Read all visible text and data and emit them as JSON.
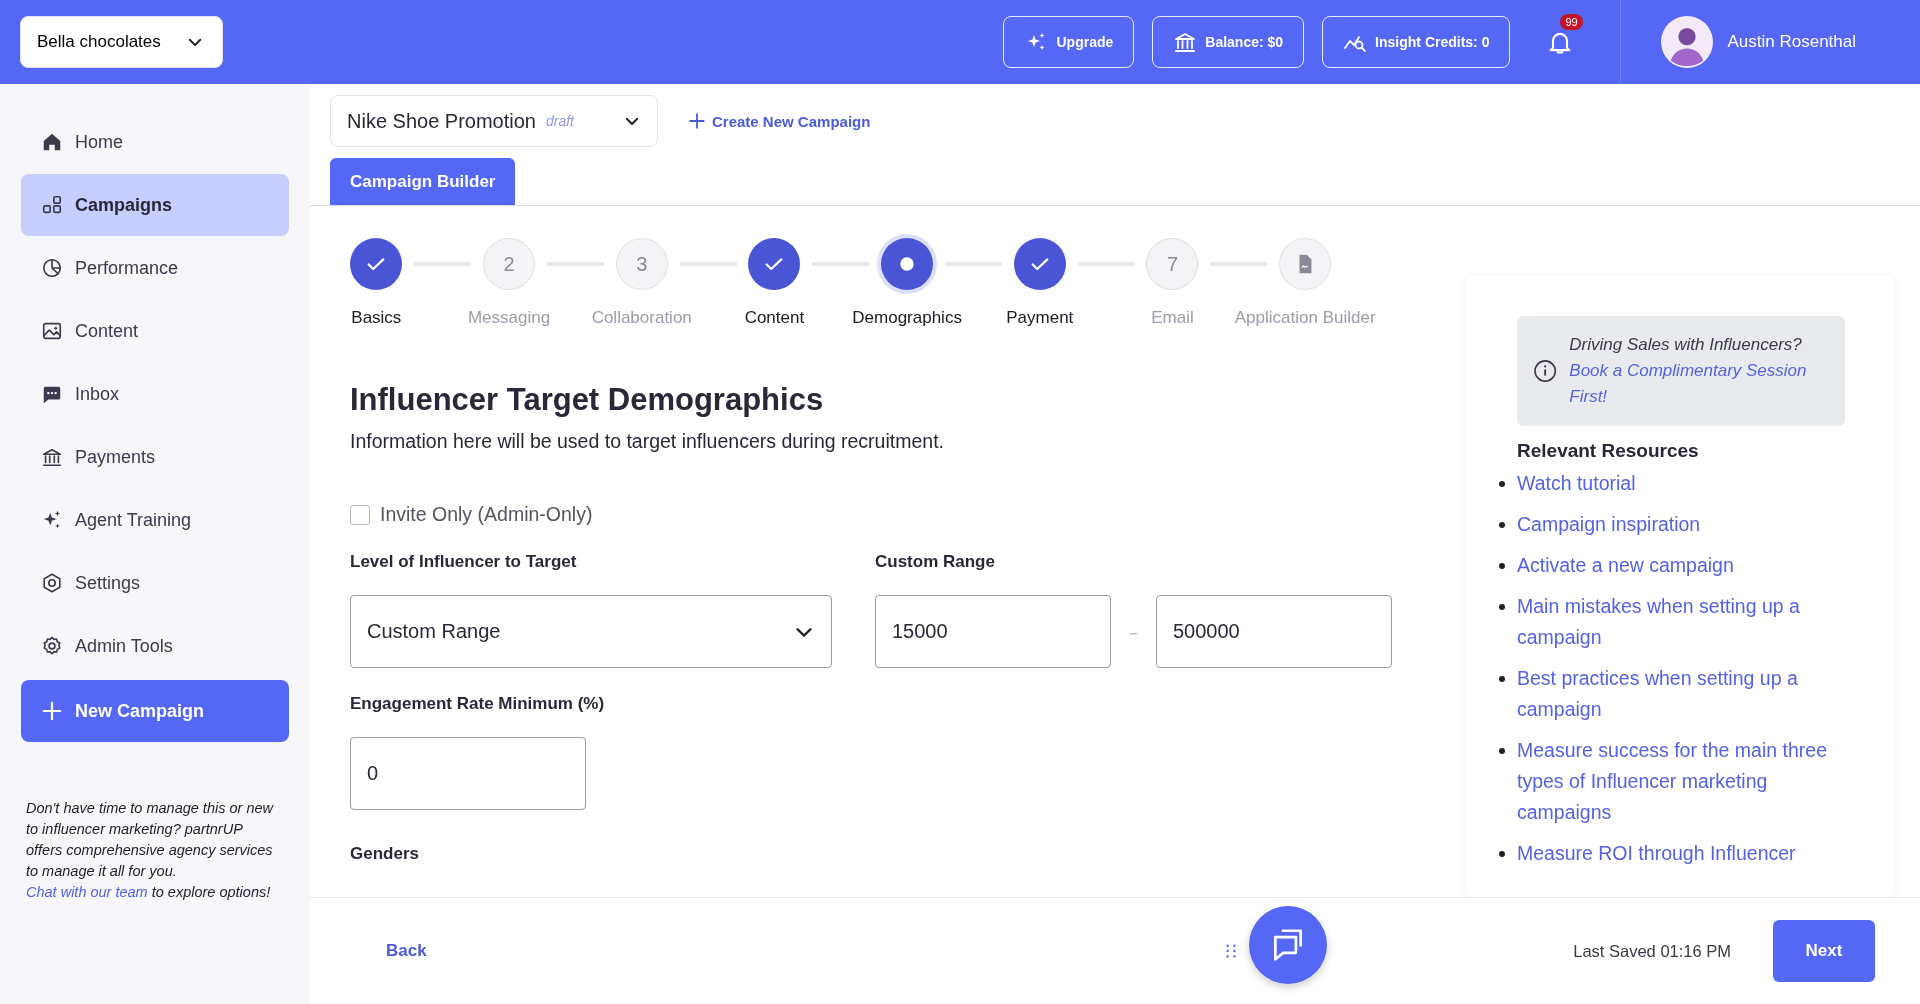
{
  "topbar": {
    "brand_selector": "Bella chocolates",
    "buttons": [
      {
        "kind": "upgrade",
        "label": "Upgrade"
      },
      {
        "kind": "balance",
        "label": "Balance: $0"
      },
      {
        "kind": "credits",
        "label": "Insight Credits: 0"
      }
    ],
    "notification_count": "99",
    "user": "Austin Rosenthal"
  },
  "sidebar": {
    "items": [
      {
        "kind": "home",
        "label": "Home",
        "selected": false
      },
      {
        "kind": "campaigns",
        "label": "Campaigns",
        "selected": true
      },
      {
        "kind": "performance",
        "label": "Performance",
        "selected": false
      },
      {
        "kind": "content",
        "label": "Content",
        "selected": false
      },
      {
        "kind": "inbox",
        "label": "Inbox",
        "selected": false
      },
      {
        "kind": "payments",
        "label": "Payments",
        "selected": false
      },
      {
        "kind": "agent",
        "label": "Agent Training",
        "selected": false
      },
      {
        "kind": "settings",
        "label": "Settings",
        "selected": false
      },
      {
        "kind": "admin",
        "label": "Admin Tools",
        "selected": false
      }
    ],
    "new_campaign": "New Campaign",
    "promo": {
      "before": "Don't have time to manage this or new to influencer marketing? partnrUP offers comprehensive agency services to manage it all for you. ",
      "link": "Chat with our team",
      "after": " to explore options!"
    }
  },
  "campaign": {
    "name": "Nike Shoe Promotion",
    "status": "draft",
    "create_link": "Create New Campaign",
    "tabs": [
      {
        "label": "Campaign Builder",
        "selected": true
      }
    ]
  },
  "steps": [
    {
      "label": "Basics",
      "complete": true,
      "current": false
    },
    {
      "label": "Messaging",
      "complete": false,
      "current": false,
      "number": "2"
    },
    {
      "label": "Collaboration",
      "complete": false,
      "current": false,
      "number": "3"
    },
    {
      "label": "Content",
      "complete": true,
      "current": false
    },
    {
      "label": "Demographics",
      "complete": false,
      "current": true
    },
    {
      "label": "Payment",
      "complete": true,
      "current": false
    },
    {
      "label": "Email",
      "complete": false,
      "current": false,
      "number": "7"
    },
    {
      "label": "Application Builder",
      "complete": false,
      "current": false
    }
  ],
  "form": {
    "title": "Influencer Target Demographics",
    "description": "Information here will be used to target influencers during recruitment.",
    "invite_only": {
      "label": "Invite Only (Admin-Only)",
      "checked": false
    },
    "level": {
      "label": "Level of Influencer to Target",
      "value": "Custom Range"
    },
    "custom_range": {
      "label": "Custom Range",
      "min": "15000",
      "separator": "–",
      "max": "500000"
    },
    "engagement": {
      "label": "Engagement Rate Minimum (%)",
      "value": "0"
    },
    "genders_label": "Genders"
  },
  "help": {
    "question": "Driving Sales with Influencers?",
    "link": "Book a Complimentary Session First!"
  },
  "resources": {
    "title": "Relevant Resources",
    "links": [
      "Watch tutorial",
      "Campaign inspiration",
      "Activate a new campaign",
      "Main mistakes when setting up a campaign",
      "Best practices when setting up a campaign",
      "Measure success for the main three types of Influencer marketing campaigns",
      "Measure ROI through Influencer"
    ]
  },
  "footer": {
    "back": "Back",
    "last_saved": "Last Saved 01:16 PM",
    "next": "Next"
  }
}
